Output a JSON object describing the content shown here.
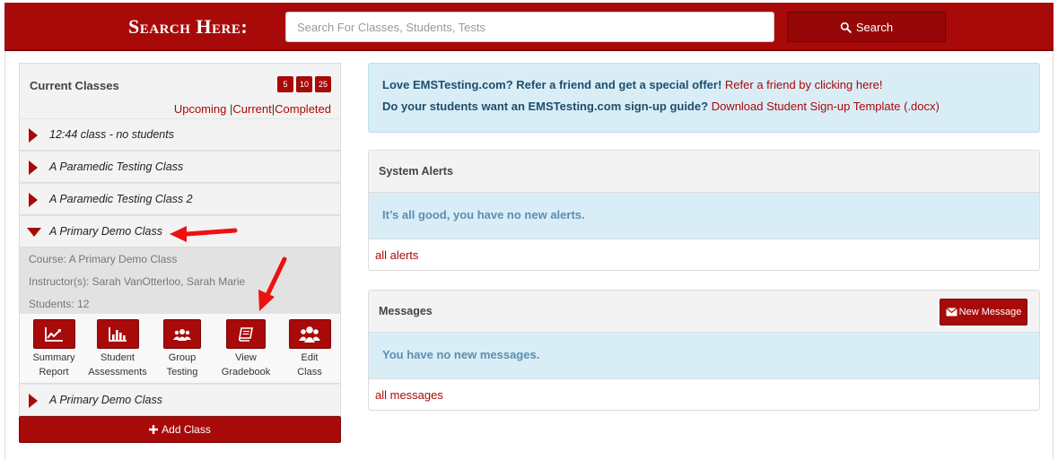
{
  "header": {
    "title": "Search Here:",
    "search_placeholder": "Search For Classes, Students, Tests",
    "search_button": "Search"
  },
  "classes_panel": {
    "title": "Current Classes",
    "page_sizes": [
      "5",
      "10",
      "25"
    ],
    "filters": {
      "upcoming": "Upcoming",
      "current": "Current",
      "completed": "Completed",
      "separator": "|"
    },
    "classes": [
      {
        "name": "12:44 class - no students",
        "expanded": false
      },
      {
        "name": "A Paramedic Testing Class",
        "expanded": false
      },
      {
        "name": "A Paramedic Testing Class 2",
        "expanded": false
      },
      {
        "name": "A Primary Demo Class",
        "expanded": true
      },
      {
        "name": "A Primary Demo Class",
        "expanded": false
      }
    ],
    "expanded_details": {
      "course": "Course: A Primary Demo Class",
      "instructors": "Instructor(s): Sarah VanOtterloo, Sarah Marie",
      "students": "Students: 12"
    },
    "actions": [
      {
        "line1": "Summary",
        "line2": "Report",
        "icon": "line-chart-icon"
      },
      {
        "line1": "Student",
        "line2": "Assessments",
        "icon": "bar-chart-icon"
      },
      {
        "line1": "Group",
        "line2": "Testing",
        "icon": "group-icon"
      },
      {
        "line1": "View",
        "line2": "Gradebook",
        "icon": "book-icon"
      },
      {
        "line1": "Edit",
        "line2": "Class",
        "icon": "users-icon"
      }
    ],
    "add_class": "Add Class"
  },
  "promo": {
    "line1_text": "Love EMSTesting.com? Refer a friend and get a special offer!",
    "line1_link": "Refer a friend by clicking here!",
    "line2_text": "Do your students want an EMSTesting.com sign-up guide?",
    "line2_link": "Download Student Sign-up Template (.docx)"
  },
  "alerts": {
    "title": "System Alerts",
    "message": "It’s all good, you have no new alerts.",
    "link": "all alerts"
  },
  "messages": {
    "title": "Messages",
    "new_button": "New Message",
    "message": "You have no new messages.",
    "link": "all messages"
  },
  "colors": {
    "brand": "#a80a0a",
    "info_bg": "#d9edf7",
    "panel_bg": "#f3f3f3"
  }
}
